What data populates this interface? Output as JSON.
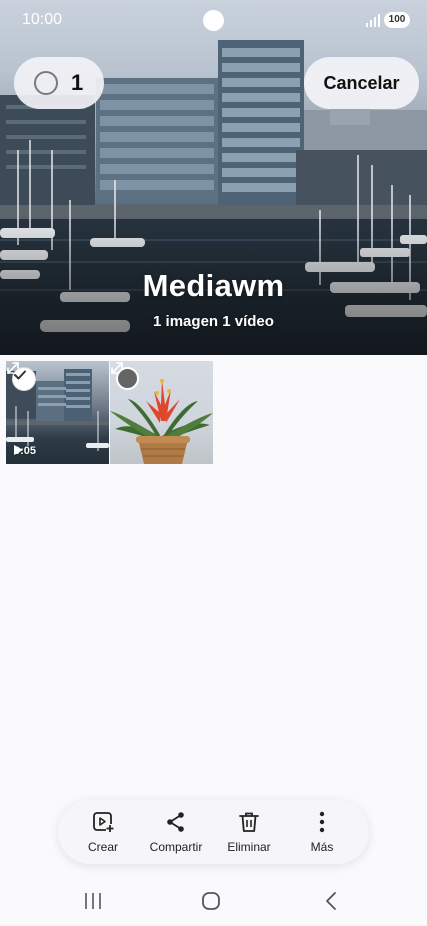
{
  "status_bar": {
    "time": "10:00",
    "battery": "100",
    "signal_icon": "signal-bars-icon"
  },
  "header": {
    "selected_count": "1",
    "cancel_label": "Cancelar",
    "album_title": "Mediawm",
    "album_subtitle": "1 imagen 1 vídeo"
  },
  "thumbnails": [
    {
      "type": "video",
      "duration": "0:05",
      "selected": true,
      "subject": "harbor buildings"
    },
    {
      "type": "image",
      "selected": false,
      "subject": "potted plant"
    }
  ],
  "actions": [
    {
      "label": "Crear",
      "icon": "create-video-icon"
    },
    {
      "label": "Compartir",
      "icon": "share-icon"
    },
    {
      "label": "Eliminar",
      "icon": "trash-icon"
    },
    {
      "label": "Más",
      "icon": "more-vertical-icon"
    }
  ],
  "navigation": {
    "recents_icon": "recents-icon",
    "home_icon": "home-icon",
    "back_icon": "back-icon"
  },
  "colors": {
    "background": "#fafafd",
    "pill_background": "#f2f2f6",
    "action_bar_background": "#f6f6f9",
    "text_primary": "#111111"
  }
}
